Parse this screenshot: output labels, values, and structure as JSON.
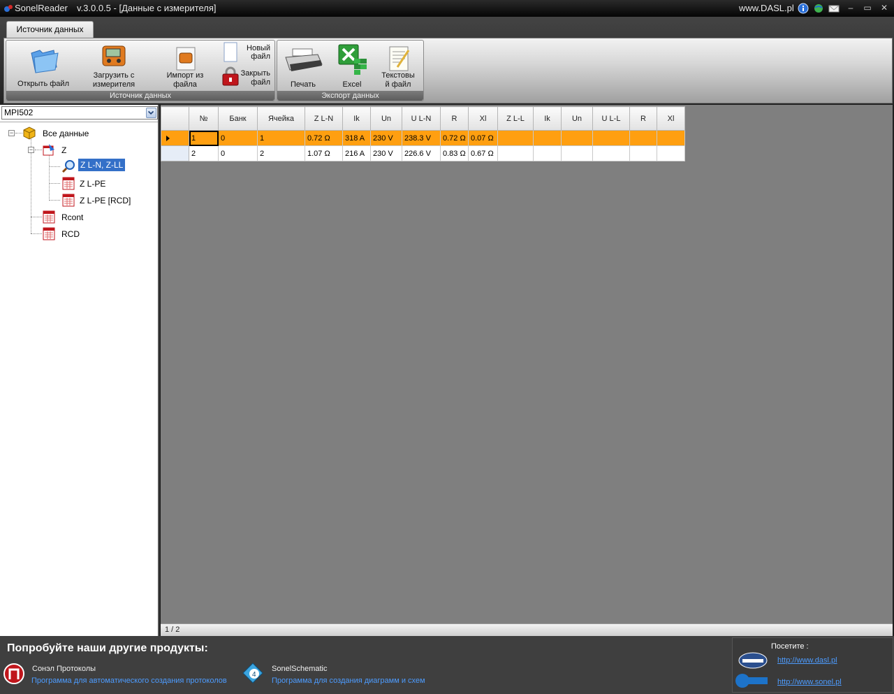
{
  "window": {
    "app_name": "SonelReader",
    "version_title": "v.3.0.0.5 - [Данные с измерителя]",
    "site": "www.DASL.pl"
  },
  "ribbon": {
    "tab_label": "Источник данных",
    "source_group": {
      "caption": "Источник данных",
      "open_file": "Открыть файл",
      "load_meter_1": "Загрузить с",
      "load_meter_2": "измерителя",
      "import_1": "Импорт из",
      "import_2": "файла",
      "new_file_1": "Новый",
      "new_file_2": "файл",
      "close_file_1": "Закрыть",
      "close_file_2": "файл"
    },
    "export_group": {
      "caption": "Экспорт данных",
      "print": "Печать",
      "excel": "Excel",
      "text_1": "Текстовы",
      "text_2": "й файл"
    }
  },
  "left_panel": {
    "device_selected": "MPI502",
    "tree": {
      "root": "Все данные",
      "z": "Z",
      "zln_zll": "Z L-N, Z-LL",
      "zlpe": "Z L-PE",
      "zlpe_rcd": "Z L-PE [RCD]",
      "rcont": "Rcont",
      "rcd": "RCD"
    }
  },
  "grid": {
    "columns": [
      "№",
      "Банк",
      "Ячейка",
      "Z L-N",
      "Ik",
      "Un",
      "U L-N",
      "R",
      "Xl",
      "Z L-L",
      "Ik",
      "Un",
      "U L-L",
      "R",
      "Xl"
    ],
    "rows": [
      [
        "1",
        "0",
        "1",
        "0.72 Ω",
        "318 A",
        "230 V",
        "238.3 V",
        "0.72 Ω",
        "0.07 Ω",
        "",
        "",
        "",
        "",
        "",
        ""
      ],
      [
        "2",
        "0",
        "2",
        "1.07 Ω",
        "216 A",
        "230 V",
        "226.6 V",
        "0.83 Ω",
        "0.67 Ω",
        "",
        "",
        "",
        "",
        "",
        ""
      ]
    ],
    "selected_row": 0,
    "pager": "1 / 2"
  },
  "footer": {
    "promo_title": "Попробуйте наши другие продукты:",
    "product1_name": "Сонэл Протоколы",
    "product1_desc": "Программа для автоматического создания протоколов",
    "product2_name": "SonelSchematic",
    "product2_desc": "Программа для создания диаграмм и схем",
    "visit_title": "Посетите :",
    "link_dasl": "http://www.dasl.pl",
    "link_sonel": "http://www.sonel.pl"
  },
  "colors": {
    "selection_orange": "#ff9f10",
    "tree_selection": "#3470c8",
    "link_blue": "#4d9cff"
  }
}
